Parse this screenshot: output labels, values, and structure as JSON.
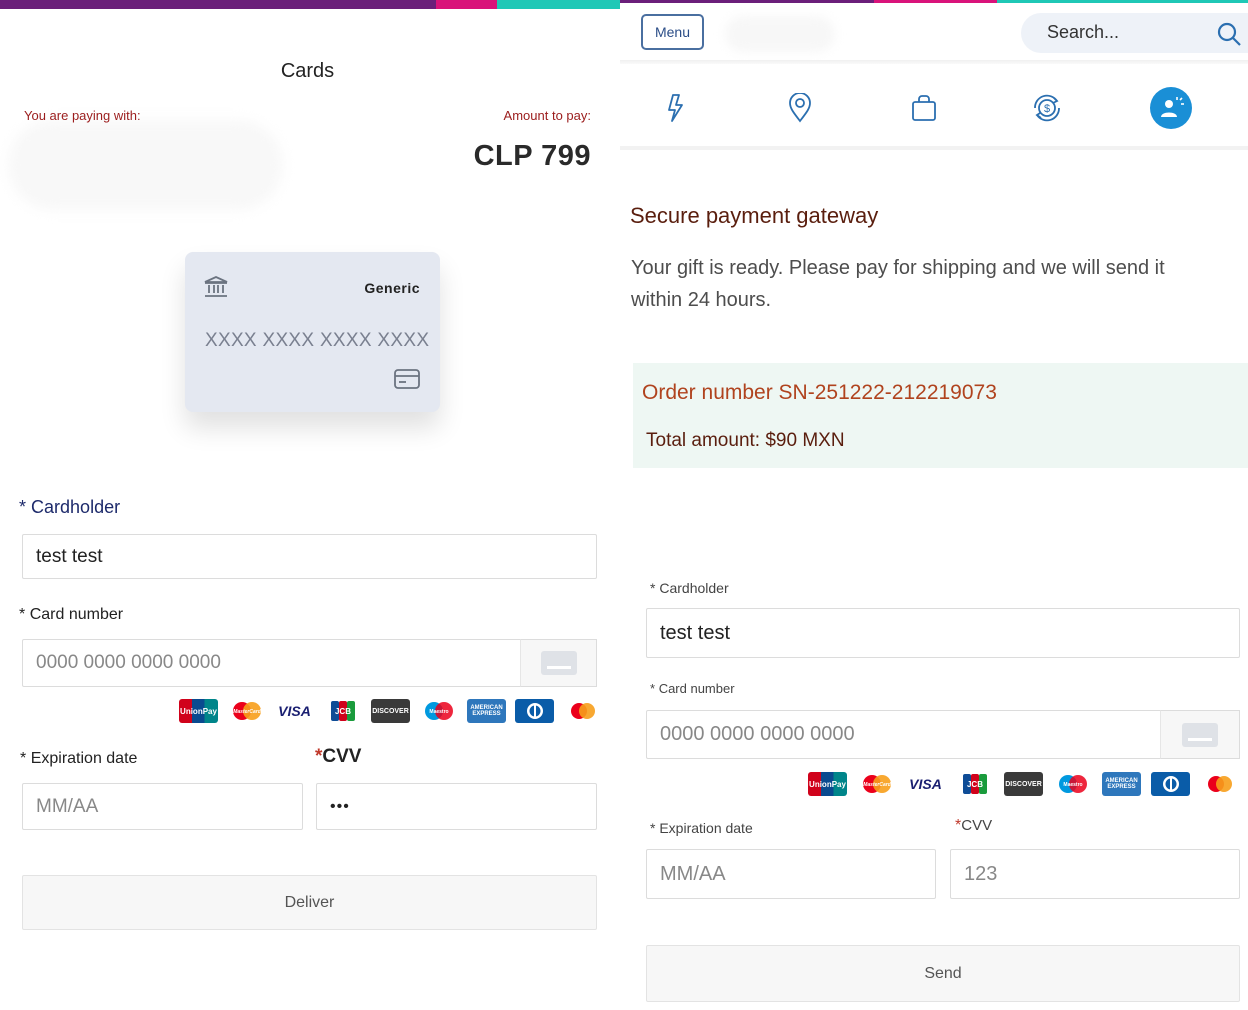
{
  "colors": {
    "topbar": [
      "#6b1f7a",
      "#d9137a",
      "#1fc8b6"
    ],
    "accent_red": "#9b1c1c",
    "menu_blue": "#2b4d87",
    "order_text": "#b0431e",
    "order_bg": "#eef7f3",
    "active_nav": "#1a8fd6"
  },
  "left": {
    "title": "Cards",
    "paying_label": "You are paying with:",
    "amount_label": "Amount to pay:",
    "amount_value": "CLP 799",
    "card": {
      "brand": "Generic",
      "number": "XXXX XXXX XXXX XXXX",
      "bank_icon": "bank-icon",
      "chip_icon": "credit-card-icon"
    },
    "form": {
      "cardholder_label": "Cardholder",
      "cardholder_value": "test test",
      "card_number_label": "Card number",
      "card_number_placeholder": "0000 0000 0000 0000",
      "expiration_label": "Expiration date",
      "expiration_placeholder": "MM/AA",
      "cvv_label": "CVV",
      "cvv_value": "•••",
      "required_mark": "*",
      "submit_label": "Deliver"
    }
  },
  "right": {
    "menu_label": "Menu",
    "search_placeholder": "Search...",
    "nav_icons": [
      "lightning-icon",
      "location-pin-icon",
      "shopping-bag-icon",
      "currency-exchange-icon",
      "user-badge-icon"
    ],
    "title": "Secure payment gateway",
    "description": "Your gift is ready. Please pay for shipping and we will send it within 24 hours.",
    "order_number": "Order number SN-251222-212219073",
    "total_amount": "Total amount: $90 MXN",
    "form": {
      "cardholder_label": "Cardholder",
      "cardholder_value": "test test",
      "card_number_label": "Card number",
      "card_number_placeholder": "0000 0000 0000 0000",
      "expiration_label": "Expiration date",
      "expiration_placeholder": "MM/AA",
      "cvv_label": "CVV",
      "cvv_placeholder": "123",
      "required_mark": "*",
      "submit_label": "Send"
    }
  },
  "card_brands": [
    {
      "name": "unionpay-icon",
      "label": "UnionPay"
    },
    {
      "name": "mastercard-classic-icon",
      "label": "MasterCard"
    },
    {
      "name": "visa-icon",
      "label": "VISA"
    },
    {
      "name": "jcb-icon",
      "label": "JCB"
    },
    {
      "name": "discover-icon",
      "label": "DISCOVER"
    },
    {
      "name": "maestro-icon",
      "label": "Maestro"
    },
    {
      "name": "amex-icon",
      "label": "AMERICAN EXPRESS"
    },
    {
      "name": "diners-icon",
      "label": "Diners"
    },
    {
      "name": "mastercard-icon",
      "label": ""
    }
  ]
}
